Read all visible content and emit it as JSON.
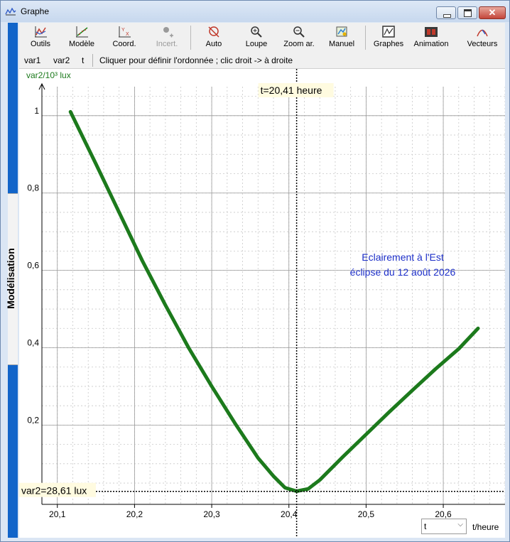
{
  "window": {
    "title": "Graphe"
  },
  "side_tab": {
    "label": "Modélisation"
  },
  "toolbar": [
    {
      "id": "outils",
      "label": "Outils",
      "icon": "axes-chart-icon",
      "enabled": true
    },
    {
      "id": "modele",
      "label": "Modèle",
      "icon": "model-curve-icon",
      "enabled": true
    },
    {
      "id": "coord",
      "label": "Coord.",
      "icon": "coordinates-icon",
      "enabled": true
    },
    {
      "id": "incert",
      "label": "Incert.",
      "icon": "uncertainty-icon",
      "enabled": false
    },
    {
      "id": "auto",
      "label": "Auto",
      "icon": "auto-scale-icon",
      "enabled": true
    },
    {
      "id": "loupe",
      "label": "Loupe",
      "icon": "zoom-in-icon",
      "enabled": true
    },
    {
      "id": "zoomar",
      "label": "Zoom ar.",
      "icon": "zoom-out-icon",
      "enabled": true
    },
    {
      "id": "manuel",
      "label": "Manuel",
      "icon": "manual-icon",
      "enabled": true
    },
    {
      "id": "graphes",
      "label": "Graphes",
      "icon": "graphs-icon",
      "enabled": true
    },
    {
      "id": "animation",
      "label": "Animation",
      "icon": "film-icon",
      "enabled": true
    },
    {
      "id": "vecteurs",
      "label": "Vecteurs",
      "icon": "vectors-icon",
      "enabled": true
    }
  ],
  "varbar": {
    "var1": "var1",
    "var2": "var2",
    "t": "t",
    "hint": "Cliquer pour définir l'ordonnée ; clic droit -> à droite"
  },
  "x_selector": {
    "value": "t"
  },
  "x_unit": "t/heure",
  "cursor": {
    "x_readout": "t=20,41 heure",
    "y_readout": "var2=28,61 lux",
    "x_value": 20.41,
    "y_value": 0.02861
  },
  "colors": {
    "curve": "#1c7a1c",
    "annotation": "#1d2fc8",
    "readout_bg": "#fffbe0",
    "side_tab": "#1164c9"
  },
  "chart_data": {
    "type": "line",
    "ylabel": "var2/10³ lux",
    "xlabel": "t/heure",
    "xlim": [
      20.08,
      20.68
    ],
    "ylim": [
      -0.005,
      1.075
    ],
    "x_ticks": [
      "20,1",
      "20,2",
      "20,3",
      "20,4",
      "20,5",
      "20,6"
    ],
    "y_ticks": [
      "0,2",
      "0,4",
      "0,6",
      "0,8",
      "1"
    ],
    "grid": true,
    "annotation": [
      "Eclairement à l'Est",
      "éclipse du 12 août 2026"
    ],
    "series": [
      {
        "x": [
          20.117,
          20.15,
          20.18,
          20.21,
          20.24,
          20.27,
          20.3,
          20.33,
          20.36,
          20.38,
          20.395,
          20.41,
          20.425,
          20.44,
          20.47,
          20.5,
          20.53,
          20.56,
          20.59,
          20.62,
          20.645
        ],
        "y": [
          1.01,
          0.875,
          0.75,
          0.625,
          0.51,
          0.4,
          0.3,
          0.205,
          0.115,
          0.068,
          0.038,
          0.029,
          0.035,
          0.058,
          0.118,
          0.176,
          0.234,
          0.29,
          0.345,
          0.397,
          0.45
        ]
      }
    ]
  }
}
